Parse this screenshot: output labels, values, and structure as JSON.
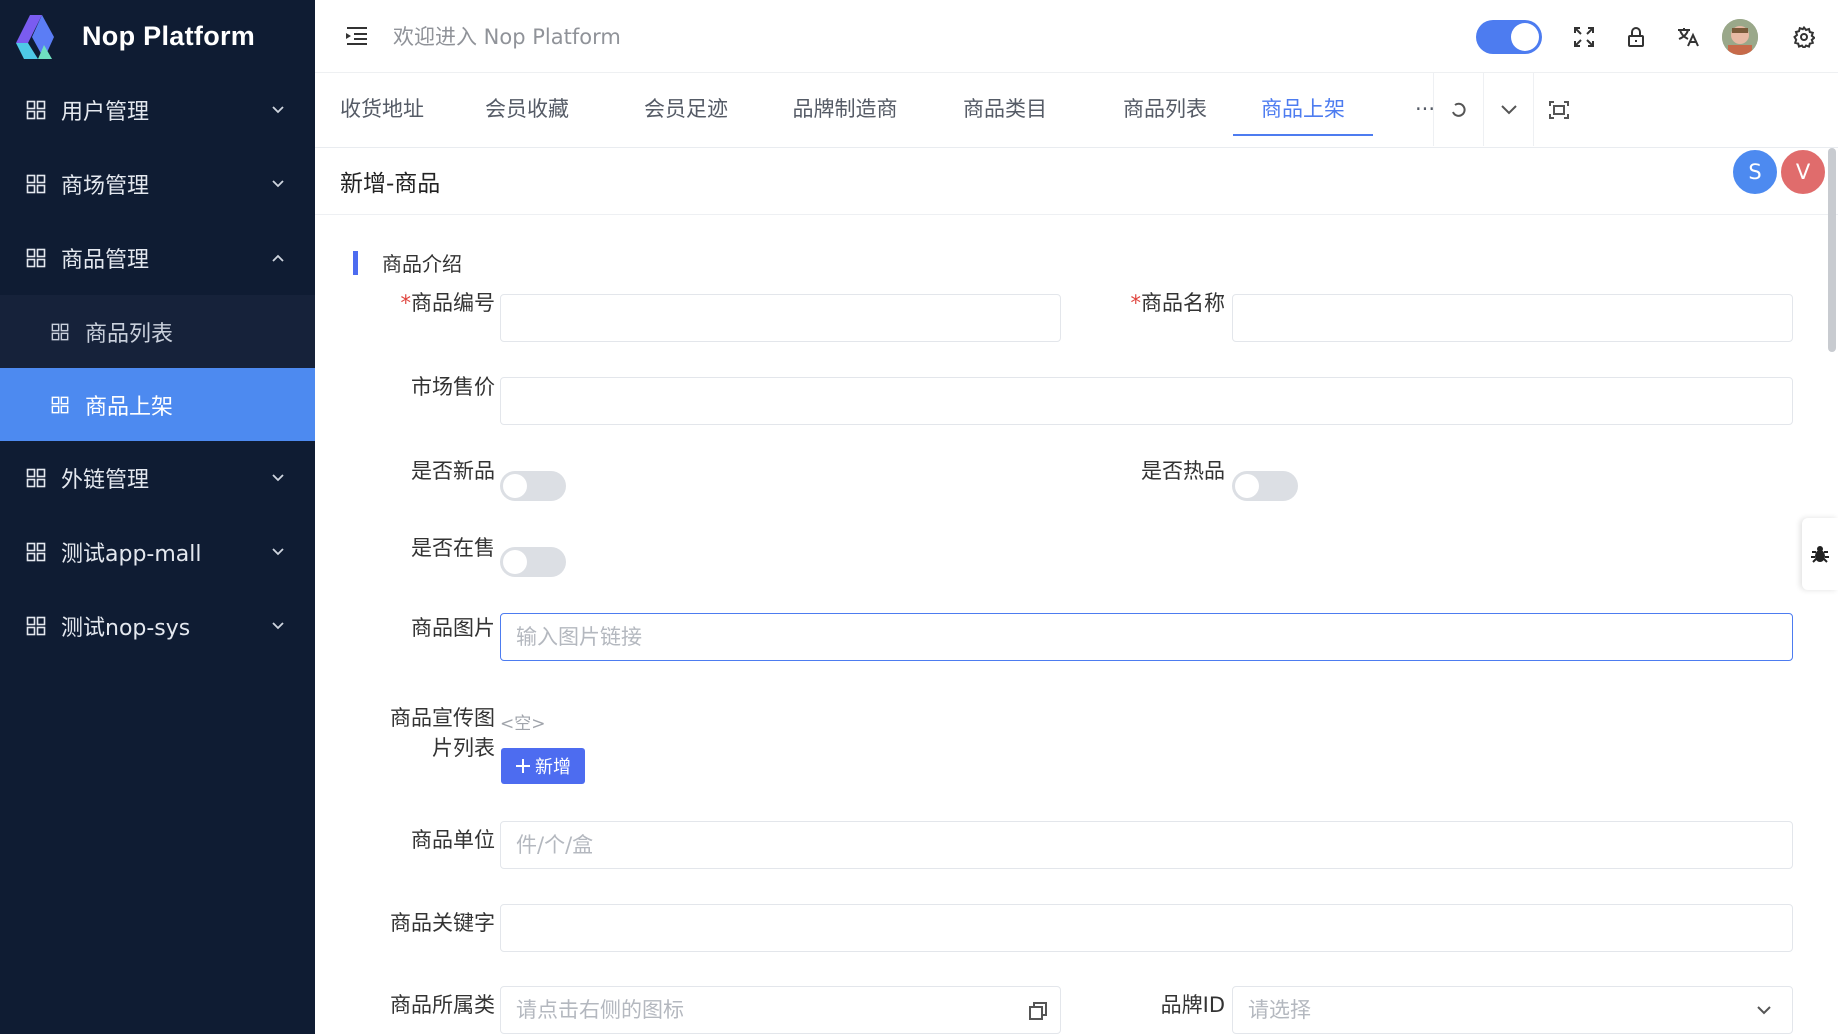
{
  "app": {
    "name": "Nop Platform"
  },
  "sidebar": {
    "items": [
      {
        "label": "用户管理",
        "expanded": false
      },
      {
        "label": "商场管理",
        "expanded": false
      },
      {
        "label": "商品管理",
        "expanded": true
      },
      {
        "label": "商品列表",
        "sub": true,
        "active": false
      },
      {
        "label": "商品上架",
        "sub": true,
        "active": true
      },
      {
        "label": "外链管理",
        "expanded": false
      },
      {
        "label": "测试app-mall",
        "expanded": false
      },
      {
        "label": "测试nop-sys",
        "expanded": false
      }
    ]
  },
  "header": {
    "welcome": "欢迎进入 Nop Platform"
  },
  "tabs": [
    {
      "label": "收货地址",
      "active": false
    },
    {
      "label": "会员收藏",
      "active": false
    },
    {
      "label": "会员足迹",
      "active": false
    },
    {
      "label": "品牌制造商",
      "active": false
    },
    {
      "label": "商品类目",
      "active": false
    },
    {
      "label": "商品列表",
      "active": false
    },
    {
      "label": "商品上架",
      "active": true
    }
  ],
  "tab_more": "···",
  "page": {
    "title": "新增-商品",
    "section": "商品介绍",
    "collaborators": [
      {
        "initial": "S",
        "color": "#4d8af0"
      },
      {
        "initial": "V",
        "color": "#e06c6c"
      }
    ]
  },
  "form": {
    "goods_sn": {
      "label": "商品编号",
      "required": "*"
    },
    "name": {
      "label": "商品名称",
      "required": "*"
    },
    "retail_price": {
      "label": "市场售价"
    },
    "is_new": {
      "label": "是否新品",
      "checked": false
    },
    "is_hot": {
      "label": "是否热品",
      "checked": false
    },
    "is_on_sale": {
      "label": "是否在售",
      "checked": false
    },
    "pic_url": {
      "label": "商品图片",
      "placeholder": "输入图片链接"
    },
    "gallery": {
      "label_line1": "商品宣传图",
      "label_line2": "片列表",
      "empty": "<空>",
      "add_label": "新增"
    },
    "unit": {
      "label": "商品单位",
      "placeholder": "件/个/盒"
    },
    "keywords": {
      "label": "商品关键字"
    },
    "category": {
      "label_line1": "商品所属类",
      "placeholder": "请点击右侧的图标"
    },
    "brand": {
      "label": "品牌ID",
      "placeholder": "请选择"
    }
  }
}
